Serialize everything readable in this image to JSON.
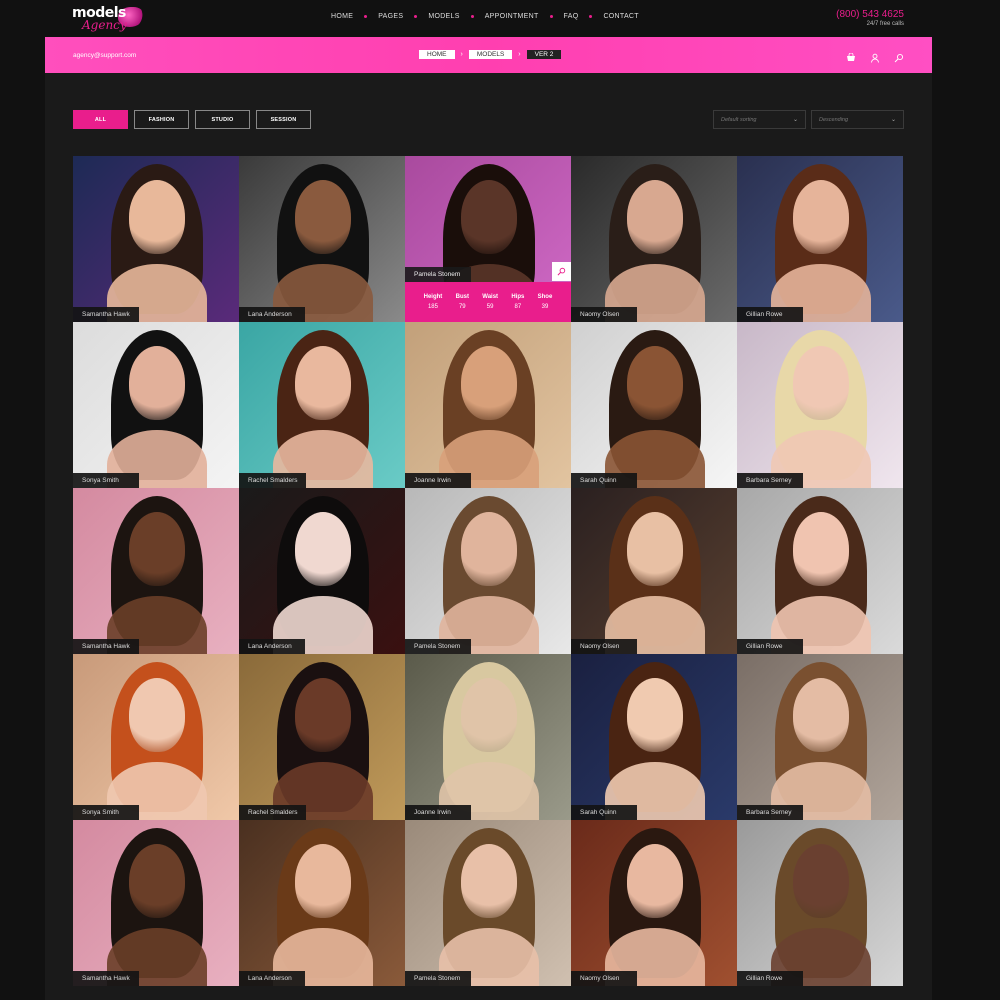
{
  "brand": {
    "logo_text": "models",
    "logo_script": "Agency",
    "accent": "#e91e8c"
  },
  "nav": [
    "HOME",
    "PAGES",
    "MODELS",
    "APPOINTMENT",
    "FAQ",
    "CONTACT"
  ],
  "phone": {
    "number": "(800) 543 4625",
    "sub": "24/7 free calls"
  },
  "bar": {
    "email": "agency@support.com",
    "breadcrumbs": [
      "HOME",
      "MODELS",
      "VER 2"
    ],
    "icons": [
      "cart-icon",
      "user-icon",
      "search-icon"
    ]
  },
  "filters": [
    "ALL",
    "FASHION",
    "STUDIO",
    "SESSION"
  ],
  "sorting": {
    "order_by": "Default sorting",
    "direction": "Descending"
  },
  "hover_card": {
    "name": "Pamela Stonem",
    "stats": [
      {
        "label": "Height",
        "value": "185"
      },
      {
        "label": "Bust",
        "value": "79"
      },
      {
        "label": "Waist",
        "value": "59"
      },
      {
        "label": "Hips",
        "value": "87"
      },
      {
        "label": "Shoe",
        "value": "39"
      }
    ]
  },
  "models": [
    "Samantha Hawk",
    "Lana Anderson",
    "Pamela Stonem",
    "Naomy Olsen",
    "Gillian Rowe",
    "Sonya Smith",
    "Rachel Smalders",
    "Joanne Irwin",
    "Sarah Quinn",
    "Barbara Serney",
    "Samantha Hawk",
    "Lana Anderson",
    "Pamela Stonem",
    "Naomy Olsen",
    "Gillian Rowe",
    "Sonya Smith",
    "Rachel Smalders",
    "Joanne Irwin",
    "Sarah Quinn",
    "Barbara Serney",
    "Samantha Hawk",
    "Lana Anderson",
    "Pamela Stonem",
    "Naomy Olsen",
    "Gillian Rowe"
  ]
}
